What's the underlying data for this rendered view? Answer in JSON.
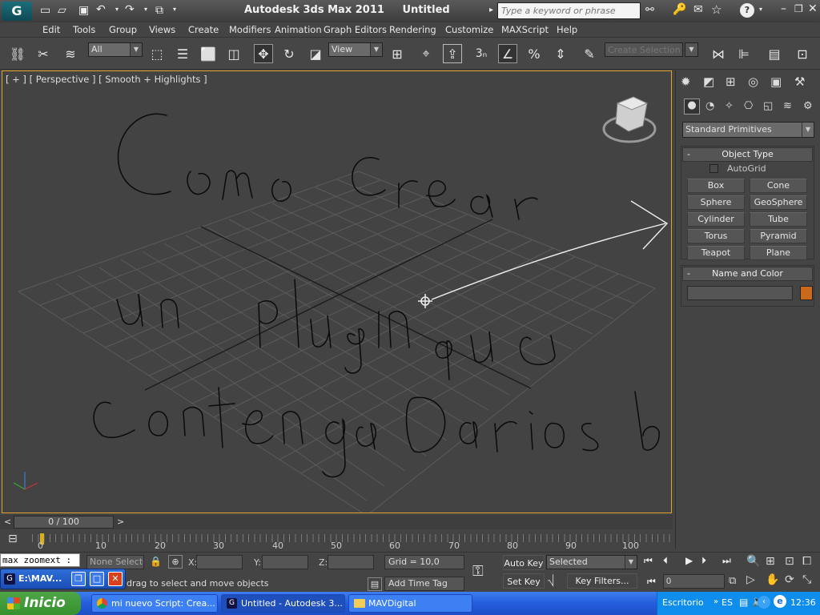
{
  "titlebar": {
    "app_title": "Autodesk 3ds Max  2011",
    "doc_title": "Untitled",
    "search_placeholder": "Type a keyword or phrase"
  },
  "menu": [
    "Edit",
    "Tools",
    "Group",
    "Views",
    "Create",
    "Modifiers",
    "Animation",
    "Graph Editors",
    "Rendering",
    "Customize",
    "MAXScript",
    "Help"
  ],
  "toolbar": {
    "selection_filter": "All",
    "ref_coord": "View",
    "named_selection_placeholder": "Create Selection Se",
    "snap_label": "3",
    "icon_names": [
      "link-icon",
      "unlink-icon",
      "bind-space-warp-icon",
      "select-object-icon",
      "select-by-name-icon",
      "rect-selection-icon",
      "window-crossing-icon",
      "select-move-icon",
      "rotate-icon",
      "scale-icon",
      "pivot-icon",
      "manipulate-icon",
      "keyboard-shortcut-icon",
      "snap-toggle-icon",
      "angle-snap-icon",
      "percent-snap-icon",
      "spinner-snap-icon",
      "edit-named-selection-icon",
      "mirror-icon",
      "align-icon",
      "layer-manager-icon",
      "curve-editor-icon"
    ]
  },
  "viewport": {
    "label": "[ + ] [ Perspective ] [ Smooth + Highlights ]"
  },
  "command_panel": {
    "category_dropdown": "Standard Primitives",
    "object_type_title": "Object Type",
    "autogrid_label": "AutoGrid",
    "buttons": [
      "Box",
      "Cone",
      "Sphere",
      "GeoSphere",
      "Cylinder",
      "Tube",
      "Torus",
      "Pyramid",
      "Teapot",
      "Plane"
    ],
    "name_color_title": "Name and Color",
    "object_color": "#c8691c"
  },
  "timeslider": {
    "frame_display": "0 / 100",
    "prev_label": "<",
    "next_label": ">",
    "ticks": [
      "0",
      "10",
      "20",
      "30",
      "40",
      "50",
      "60",
      "70",
      "80",
      "90",
      "100"
    ]
  },
  "status": {
    "maxscript_text": "max zoomext :",
    "selection_text": "None Selected",
    "x_label": "X:",
    "y_label": "Y:",
    "z_label": "Z:",
    "grid_text": "Grid = 10,0",
    "prompt_text": "drag to select and move objects",
    "add_time_tag": "Add Time Tag",
    "auto_key": "Auto Key",
    "set_key": "Set Key",
    "key_mode": "Selected",
    "key_filters": "Key Filters...",
    "frame_value": "0"
  },
  "floating_window": {
    "title": "E:\\MAV..."
  },
  "taskbar": {
    "start_label": "Inicio",
    "tasks": [
      "mi nuevo Script: Crea...",
      "Untitled - Autodesk 3...",
      "MAVDigital"
    ],
    "escritorio": "Escritorio",
    "lang": "ES",
    "clock": "12:36"
  }
}
